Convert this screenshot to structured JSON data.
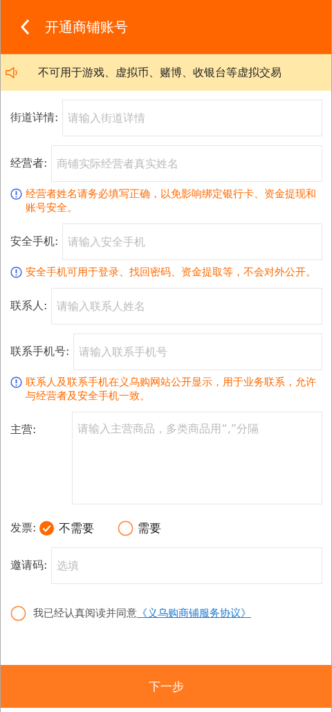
{
  "header": {
    "title": "开通商铺账号"
  },
  "notice": {
    "text": "不可用于游戏、虚拟币、赌博、收银台等虚拟交易"
  },
  "form": [
    {
      "kind": "field",
      "label": "街道详情:",
      "placeholder": "请输入街道详情"
    },
    {
      "kind": "field",
      "label": "经营者:",
      "placeholder": "商铺实际经营者真实姓名"
    },
    {
      "kind": "hint",
      "text": "经营者姓名请务必填写正确，以免影响绑定银行卡、资金提现和账号安全。"
    },
    {
      "kind": "field",
      "label": "安全手机:",
      "placeholder": "请输入安全手机"
    },
    {
      "kind": "hint",
      "text": "安全手机可用于登录、找回密码、资金提取等，不会对外公开。"
    },
    {
      "kind": "field",
      "label": "联系人:",
      "placeholder": "请输入联系人姓名"
    },
    {
      "kind": "field",
      "label": "联系手机号:",
      "placeholder": "请输入联系手机号"
    },
    {
      "kind": "hint",
      "text": "联系人及联系手机在义乌购网站公开显示，用于业务联系，允许与经营者及安全手机一致。"
    },
    {
      "kind": "textarea",
      "label": "主营:",
      "placeholder": "请输入主营商品，多类商品用“,”分隔"
    },
    {
      "kind": "radio",
      "label": "发票:",
      "options": [
        {
          "label": "不需要",
          "selected": true
        },
        {
          "label": "需要",
          "selected": false
        }
      ]
    },
    {
      "kind": "field",
      "label": "邀请码:",
      "placeholder": "选填"
    }
  ],
  "agreement": {
    "checked": false,
    "text": "我已经认真阅读并同意",
    "link": "《义乌购商铺服务协议》"
  },
  "next_button": "下一步"
}
